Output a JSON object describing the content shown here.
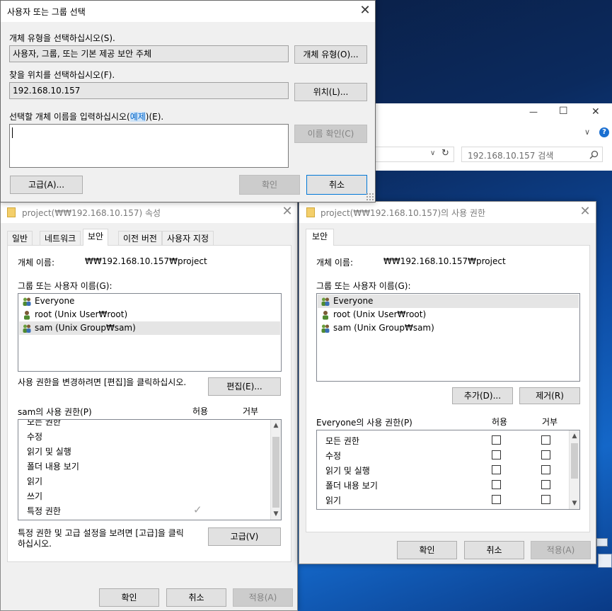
{
  "explorer": {
    "search_placeholder": "192.168.10.157 검색",
    "minimize": "—",
    "maximize": "☐",
    "close": "✕",
    "chevron": "∨",
    "help": "?",
    "refresh": "↻",
    "dropdown": "∨"
  },
  "select_dialog": {
    "title": "사용자 또는 그룹 선택",
    "object_type_label": "개체 유형을 선택하십시오(S).",
    "object_type_value": "사용자, 그룹, 또는 기본 제공 보안 주체",
    "object_type_button": "개체 유형(O)...",
    "location_label": "찾을 위치를 선택하십시오(F).",
    "location_value": "192.168.10.157",
    "location_button": "위치(L)...",
    "enter_names_label_prefix": "선택할 개체 이름을 입력하십시오(",
    "enter_names_link": "예제",
    "enter_names_label_suffix": ")(E).",
    "enter_names_value": "",
    "check_names_button": "이름 확인(C)",
    "advanced_button": "고급(A)...",
    "ok_button": "확인",
    "cancel_button": "취소"
  },
  "properties": {
    "title": "project(₩₩192.168.10.157) 속성",
    "tabs": [
      "일반",
      "네트워크",
      "보안",
      "이전 버전",
      "사용자 지정"
    ],
    "object_name_label": "개체 이름:",
    "object_name_value": "₩₩192.168.10.157₩project",
    "groups_label": "그룹 또는 사용자 이름(G):",
    "groups": [
      "Everyone",
      "root (Unix User₩root)",
      "sam (Unix Group₩sam)"
    ],
    "change_hint": "사용 권한을 변경하려면 [편집]을 클릭하십시오.",
    "edit_button": "편집(E)...",
    "perm_label": "sam의 사용 권한(P)",
    "allow_header": "허용",
    "deny_header": "거부",
    "permissions": [
      "모든 권한",
      "수정",
      "읽기 및 실행",
      "폴더 내용 보기",
      "읽기",
      "쓰기",
      "특정 권한"
    ],
    "special_allow_check": "✓",
    "advanced_hint_line1": "특정 권한 및 고급 설정을 보려면 [고급]을 클릭",
    "advanced_hint_line2": "하십시오.",
    "advanced_button": "고급(V)",
    "ok_button": "확인",
    "cancel_button": "취소",
    "apply_button": "적용(A)"
  },
  "permissions_dialog": {
    "title": "project(₩₩192.168.10.157)의 사용 권한",
    "tab": "보안",
    "object_name_label": "개체 이름:",
    "object_name_value": "₩₩192.168.10.157₩project",
    "groups_label": "그룹 또는 사용자 이름(G):",
    "groups": [
      "Everyone",
      "root (Unix User₩root)",
      "sam (Unix Group₩sam)"
    ],
    "add_button": "추가(D)...",
    "remove_button": "제거(R)",
    "perm_label": "Everyone의 사용 권한(P)",
    "allow_header": "허용",
    "deny_header": "거부",
    "permissions": [
      "모든 권한",
      "수정",
      "읽기 및 실행",
      "폴더 내용 보기",
      "읽기"
    ],
    "ok_button": "확인",
    "cancel_button": "취소",
    "apply_button": "적용(A)"
  }
}
